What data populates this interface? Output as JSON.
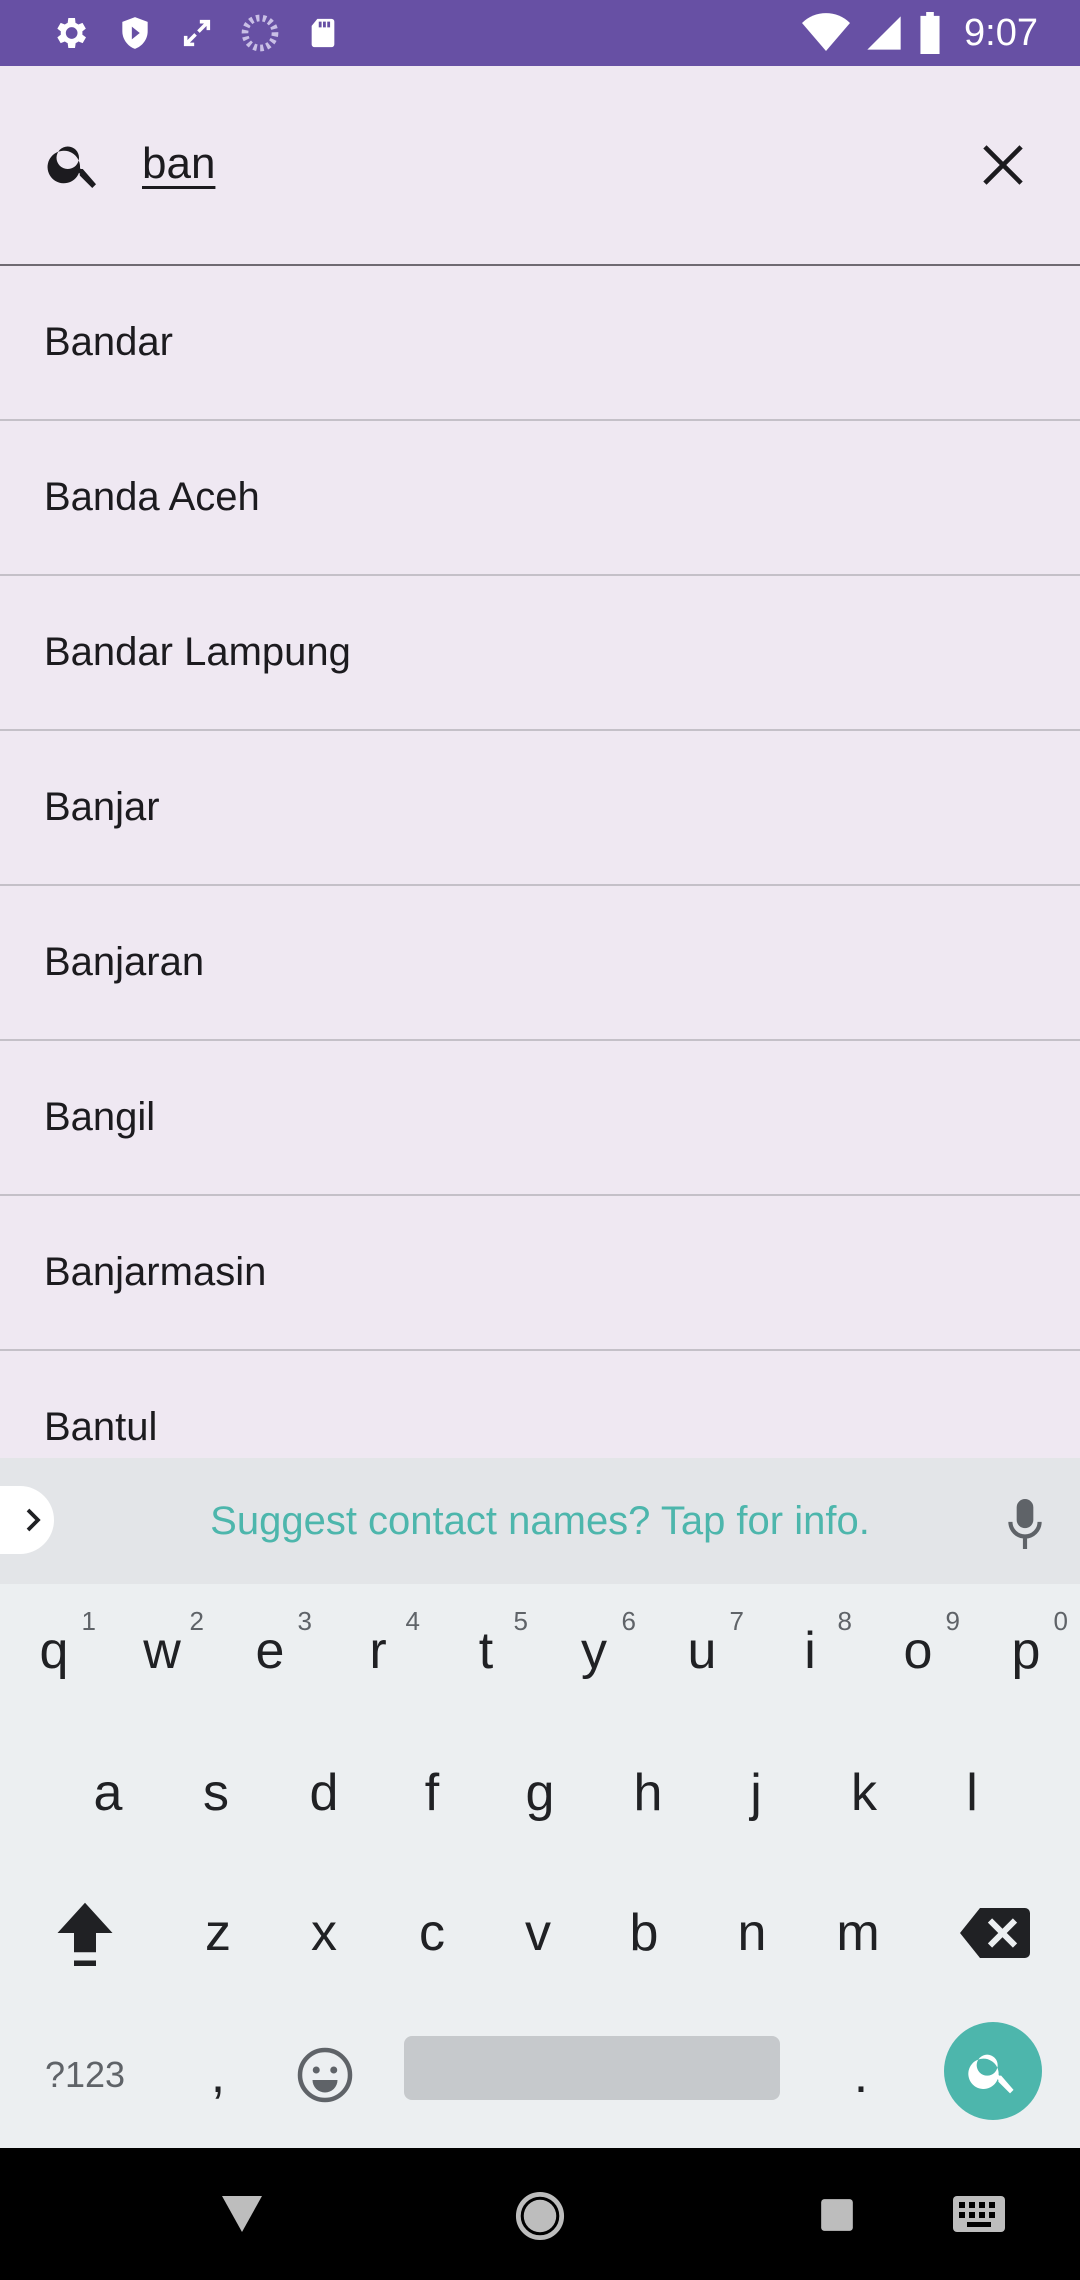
{
  "status_bar": {
    "time": "9:07",
    "left_icons": [
      "settings-icon",
      "shield-icon",
      "expand-icon",
      "loading-icon",
      "sd-card-icon"
    ],
    "right_icons": [
      "wifi-icon",
      "signal-icon",
      "battery-icon"
    ]
  },
  "search": {
    "query": "ban",
    "icon": "search-icon",
    "clear_icon": "close-icon"
  },
  "results": [
    {
      "label": "Bandar"
    },
    {
      "label": "Banda Aceh"
    },
    {
      "label": "Bandar Lampung"
    },
    {
      "label": "Banjar"
    },
    {
      "label": "Banjaran"
    },
    {
      "label": "Bangil"
    },
    {
      "label": "Banjarmasin"
    },
    {
      "label": "Bantul"
    }
  ],
  "keyboard": {
    "suggestion_text": "Suggest contact names? Tap for info.",
    "row1": [
      {
        "key": "q",
        "hint": "1"
      },
      {
        "key": "w",
        "hint": "2"
      },
      {
        "key": "e",
        "hint": "3"
      },
      {
        "key": "r",
        "hint": "4"
      },
      {
        "key": "t",
        "hint": "5"
      },
      {
        "key": "y",
        "hint": "6"
      },
      {
        "key": "u",
        "hint": "7"
      },
      {
        "key": "i",
        "hint": "8"
      },
      {
        "key": "o",
        "hint": "9"
      },
      {
        "key": "p",
        "hint": "0"
      }
    ],
    "row2": [
      "a",
      "s",
      "d",
      "f",
      "g",
      "h",
      "j",
      "k",
      "l"
    ],
    "row3": [
      "z",
      "x",
      "c",
      "v",
      "b",
      "n",
      "m"
    ],
    "symbols_label": "?123",
    "comma_label": ",",
    "period_label": ".",
    "accent_color": "#4db6ac"
  },
  "colors": {
    "status_bar": "#6750a4",
    "background": "#efe8f2"
  }
}
